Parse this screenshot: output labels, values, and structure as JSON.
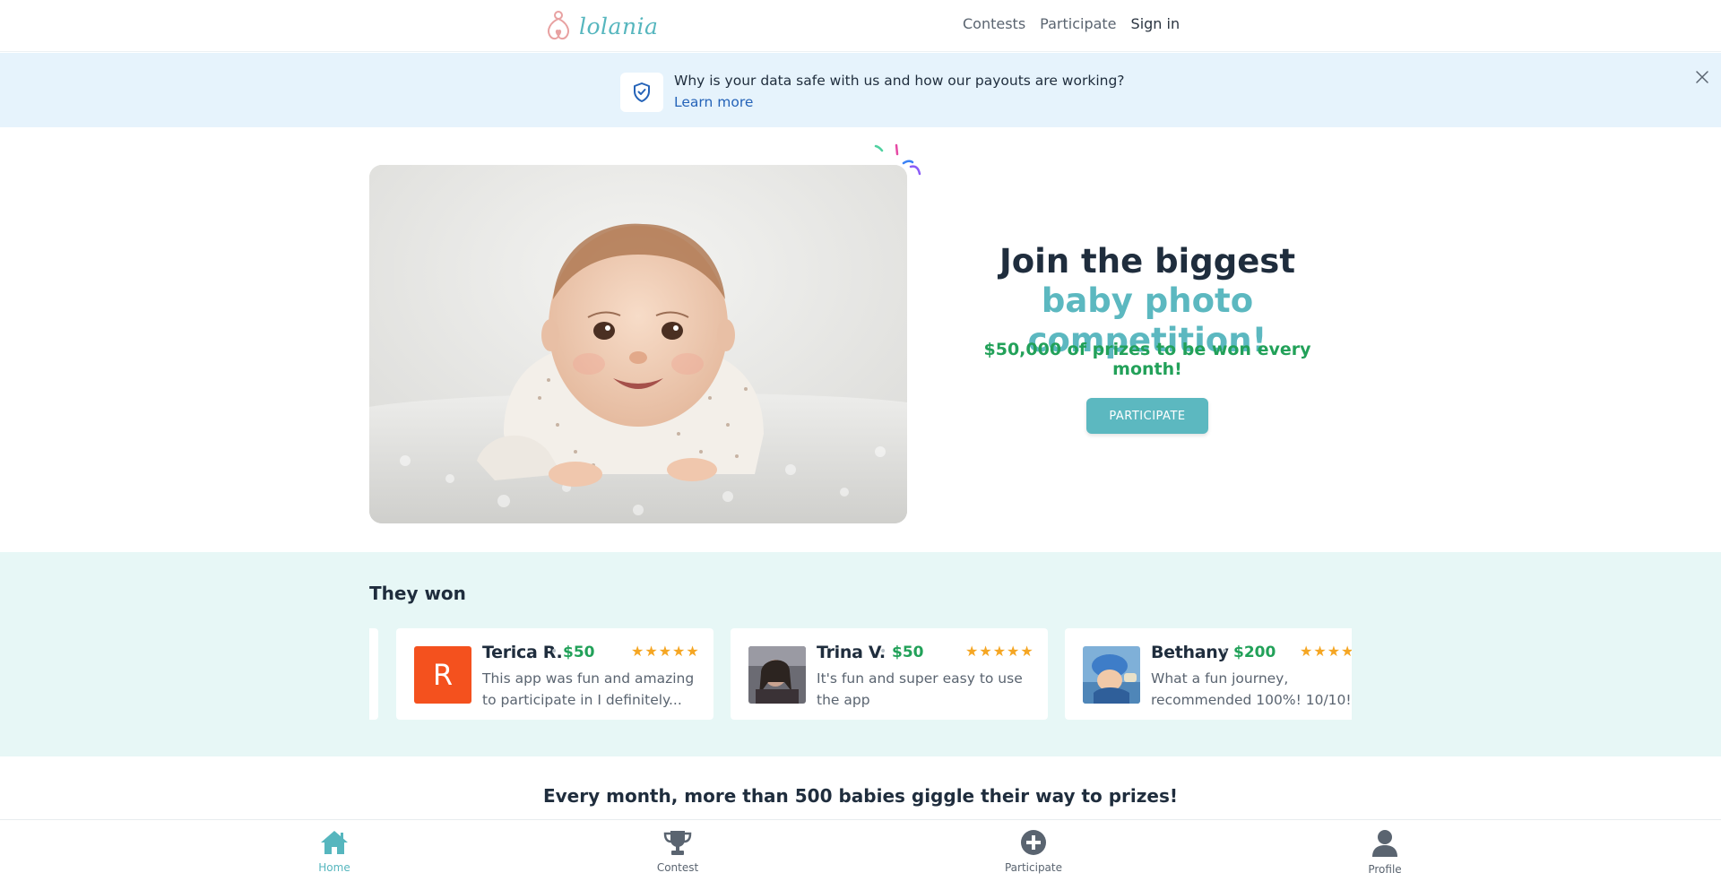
{
  "header": {
    "logo_text": "lolania",
    "nav": [
      "Contests",
      "Participate",
      "Sign in"
    ]
  },
  "banner": {
    "text": "Why is your data safe with us and how our payouts are working?",
    "link": "Learn more",
    "icon": "shield-check-icon",
    "close_icon": "close-icon"
  },
  "hero": {
    "title_part1": "Join the biggest ",
    "title_accent": "baby photo competition!",
    "prize_amount": "$50,000",
    "prize_text": " of prizes to be won every month!",
    "button": "PARTICIPATE"
  },
  "winners": {
    "title": "They won",
    "items": [
      {
        "name": "Terica R.",
        "amount": "$50",
        "stars": "★★★★★",
        "rating": 5,
        "text": "This app was fun and amazing to participate in I definitely...",
        "avatar_letter": "R",
        "avatar_color": "#f4511e"
      },
      {
        "name": "Trina V.",
        "amount": "$50",
        "stars": "★★★★★",
        "rating": 5,
        "text": "It's fun and super easy to use the app"
      },
      {
        "name": "Bethany",
        "amount": "$200",
        "stars": "★★★★★",
        "rating": 5,
        "text": "What a fun journey, recommended 100%! 10/10!"
      }
    ]
  },
  "tagline": "Every month, more than 500 babies giggle their way to prizes!",
  "bottom_nav": [
    {
      "label": "Home",
      "icon": "home-icon",
      "active": true
    },
    {
      "label": "Contest",
      "icon": "trophy-icon",
      "active": false
    },
    {
      "label": "Participate",
      "icon": "plus-circle-icon",
      "active": false
    },
    {
      "label": "Profile",
      "icon": "user-icon",
      "active": false
    }
  ],
  "colors": {
    "accent": "#5cb8c0",
    "prize_green": "#22a159",
    "banner_bg": "#e6f3fc",
    "winners_bg": "#e7f7f6",
    "link_blue": "#2563b8",
    "star_gold": "#f5a623"
  }
}
